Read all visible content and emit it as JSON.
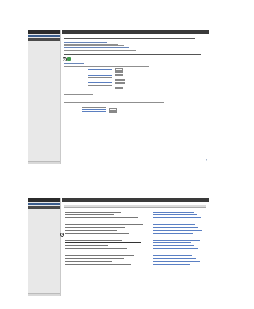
{
  "screen_top": {
    "sidebar": {
      "items": [
        {
          "label": ""
        },
        {
          "label": ""
        },
        {
          "label": ""
        }
      ],
      "footer": ""
    },
    "topbar": {
      "cells": [
        "",
        "",
        "",
        ""
      ]
    },
    "step_number": "1",
    "form": {
      "title": "",
      "subtitle": ""
    }
  },
  "screen_bottom": {
    "sidebar": {
      "items": [
        {
          "label": ""
        },
        {
          "label": ""
        },
        {
          "label": ""
        }
      ],
      "footer": ""
    },
    "topbar": {
      "cells": [
        "",
        ""
      ]
    },
    "step_number": "2",
    "table": {
      "headers": [
        "",
        ""
      ],
      "row_count": 20
    }
  },
  "colors": {
    "sidebar_active": "#3b5d8c",
    "topbar": "#3a3a3a",
    "link": "#5b80c4",
    "step_icon": "#3f9a4a"
  },
  "icons": {
    "step_icon": "green-square-icon",
    "nav_next": "double-chevron-right-icon"
  }
}
